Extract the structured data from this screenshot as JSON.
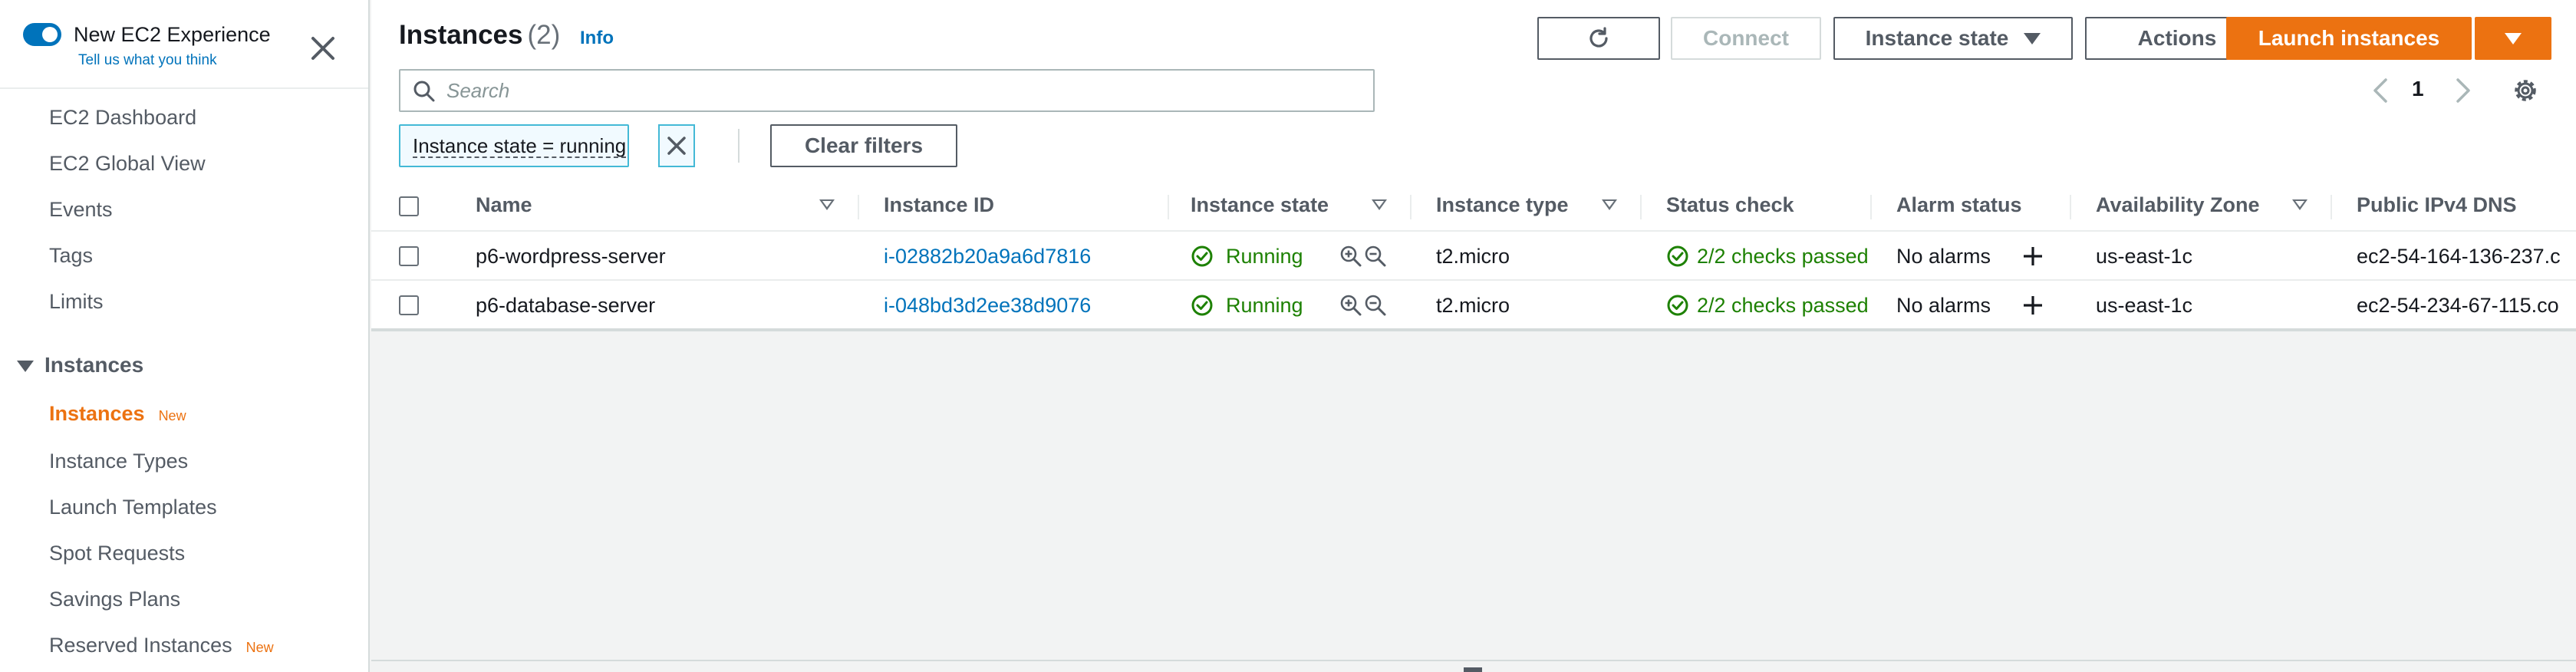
{
  "sidebar": {
    "experience_title": "New EC2 Experience",
    "experience_link": "Tell us what you think",
    "items": [
      {
        "label": "EC2 Dashboard"
      },
      {
        "label": "EC2 Global View"
      },
      {
        "label": "Events"
      },
      {
        "label": "Tags"
      },
      {
        "label": "Limits"
      }
    ],
    "section_title": "Instances",
    "section_items": [
      {
        "label": "Instances",
        "badge": "New",
        "active": true
      },
      {
        "label": "Instance Types"
      },
      {
        "label": "Launch Templates"
      },
      {
        "label": "Spot Requests"
      },
      {
        "label": "Savings Plans"
      },
      {
        "label": "Reserved Instances",
        "badge": "New"
      }
    ]
  },
  "header": {
    "title": "Instances",
    "count": "(2)",
    "info": "Info",
    "buttons": {
      "connect": "Connect",
      "instance_state": "Instance state",
      "actions": "Actions",
      "launch": "Launch instances"
    }
  },
  "search": {
    "placeholder": "Search",
    "value": ""
  },
  "pagination": {
    "current_page": "1"
  },
  "filters": {
    "chip": "Instance state = running",
    "clear": "Clear filters"
  },
  "table": {
    "columns": {
      "name": "Name",
      "instance_id": "Instance ID",
      "instance_state": "Instance state",
      "instance_type": "Instance type",
      "status_check": "Status check",
      "alarm_status": "Alarm status",
      "availability_zone": "Availability Zone",
      "public_dns": "Public IPv4 DNS"
    },
    "rows": [
      {
        "name": "p6-wordpress-server",
        "instance_id": "i-02882b20a9a6d7816",
        "state": "Running",
        "type": "t2.micro",
        "status_check": "2/2 checks passed",
        "alarm": "No alarms",
        "az": "us-east-1c",
        "dns": "ec2-54-164-136-237.c"
      },
      {
        "name": "p6-database-server",
        "instance_id": "i-048bd3d2ee38d9076",
        "state": "Running",
        "type": "t2.micro",
        "status_check": "2/2 checks passed",
        "alarm": "No alarms",
        "az": "us-east-1c",
        "dns": "ec2-54-234-67-115.co"
      }
    ]
  },
  "colors": {
    "accent": "#ec7211",
    "link": "#0073bb",
    "success": "#1d8102",
    "toggle": "#0073bb"
  }
}
